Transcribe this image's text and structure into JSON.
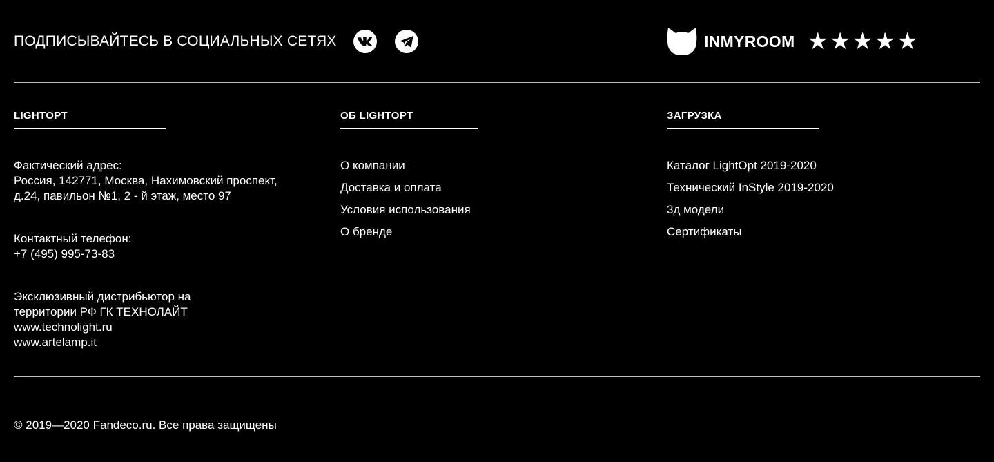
{
  "social": {
    "label": "ПОДПИСЫВАЙТЕСЬ В СОЦИАЛЬНЫХ СЕТЯХ",
    "vk_icon": "vk-icon",
    "telegram_icon": "telegram-icon"
  },
  "brand": {
    "name": "INMYROOM",
    "rating": 5,
    "rating_text": "★★★★★",
    "logo_icon": "cat-head-icon"
  },
  "columns": [
    {
      "title": "LIGHTOPT",
      "blocks": [
        {
          "lines": [
            "Фактический адрес:",
            "Россия, 142771, Москва, Нахимовский проспект,",
            "д.24, павильон №1, 2 - й этаж, место 97"
          ]
        },
        {
          "lines": [
            "Контактный телефон:",
            "+7 (495) 995-73-83"
          ]
        },
        {
          "lines": [
            "Эксклюзивный дистрибьютор на",
            "территории РФ ГК ТЕХНОЛАЙТ",
            "www.technolight.ru",
            "www.artelamp.it"
          ]
        }
      ]
    },
    {
      "title": "ОБ LIGHTOPT",
      "links": [
        "О компании",
        "Доставка и оплата",
        "Условия использования",
        "О бренде"
      ]
    },
    {
      "title": "ЗАГРУЗКА",
      "links": [
        "Каталог LightOpt 2019-2020",
        "Технический InStyle 2019-2020",
        "3д модели",
        "Сертификаты"
      ]
    }
  ],
  "copyright": "© 2019—2020 Fandeco.ru. Все права защищены",
  "colors": {
    "background": "#000000",
    "text": "#ffffff",
    "divider": "#bfbfbf"
  }
}
